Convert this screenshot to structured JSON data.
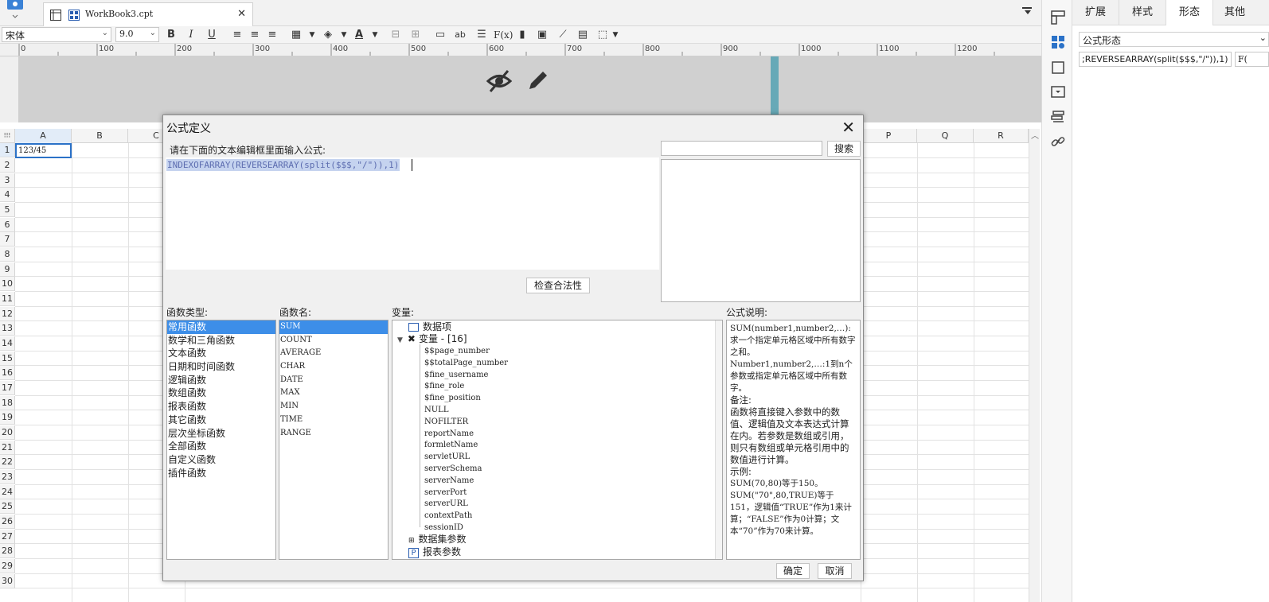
{
  "workbook_tab": {
    "label": "WorkBook3.cpt",
    "close": "✕"
  },
  "toolbar": {
    "font_name": "宋体",
    "font_size": "9.0"
  },
  "ruler": {
    "labels": [
      "0",
      "100",
      "200",
      "300",
      "400",
      "500",
      "600",
      "700",
      "800",
      "900",
      "1000",
      "1100",
      "1200"
    ]
  },
  "sheet": {
    "columns": [
      "A",
      "B",
      "C",
      "P",
      "Q",
      "R"
    ],
    "rows": [
      "1",
      "2",
      "3",
      "4",
      "5",
      "6",
      "7",
      "8",
      "9",
      "10",
      "11",
      "12",
      "13",
      "14",
      "15",
      "16",
      "17",
      "18",
      "19",
      "20",
      "21",
      "22",
      "23",
      "24",
      "25",
      "26",
      "27",
      "28",
      "29",
      "30"
    ],
    "cell_a1": "123/45"
  },
  "side_panel": {
    "tabs": [
      "扩展",
      "样式",
      "形态",
      "其他"
    ],
    "active_tab": "形态",
    "formula_form_label": "公式形态",
    "formula_value": ";REVERSEARRAY(split($$$,\"/\")),1)",
    "fx_label": "F("
  },
  "dialog": {
    "title": "公式定义",
    "prompt": "请在下面的文本编辑框里面输入公式:",
    "formula": "INDEXOFARRAY(REVERSEARRAY(split($$$,\"/\")),1)",
    "search_button": "搜索",
    "check_button": "检查合法性",
    "function_type_label": "函数类型:",
    "function_name_label": "函数名:",
    "variable_label": "变量:",
    "description_label": "公式说明:",
    "function_types": [
      "常用函数",
      "数学和三角函数",
      "文本函数",
      "日期和时间函数",
      "逻辑函数",
      "数组函数",
      "报表函数",
      "其它函数",
      "层次坐标函数",
      "全部函数",
      "自定义函数",
      "插件函数"
    ],
    "function_names": [
      "SUM",
      "COUNT",
      "AVERAGE",
      "CHAR",
      "DATE",
      "MAX",
      "MIN",
      "TIME",
      "RANGE"
    ],
    "variables": {
      "data_item": "数据项",
      "group": "变量 - [16]",
      "items": [
        "$$page_number",
        "$$totalPage_number",
        "$fine_username",
        "$fine_role",
        "$fine_position",
        "NULL",
        "NOFILTER",
        "reportName",
        "formletName",
        "servletURL",
        "serverSchema",
        "serverName",
        "serverPort",
        "serverURL",
        "contextPath",
        "sessionID"
      ],
      "dataset_params": "数据集参数",
      "report_params": "报表参数"
    },
    "description": [
      "SUM(number1,number2,…):求一个指定单元格区域中所有数字之和。",
      "Number1,number2,…:1到n个参数或指定单元格区域中所有数字。",
      "备注:",
      "函数将直接键入参数中的数值、逻辑值及文本表达式计算在内。若参数是数组或引用，则只有数组或单元格引用中的数值进行计算。",
      "示例:",
      "SUM(70,80)等于150。",
      "SUM(\"70\",80,TRUE)等于151，逻辑值“TRUE”作为1来计算；“FALSE”作为0计算；文本“70”作为70来计算。"
    ],
    "ok_button": "确定",
    "cancel_button": "取消"
  },
  "colors": {
    "selection": "#3d8ee8",
    "accent": "#2b72c8",
    "band": "#67a9b7"
  }
}
